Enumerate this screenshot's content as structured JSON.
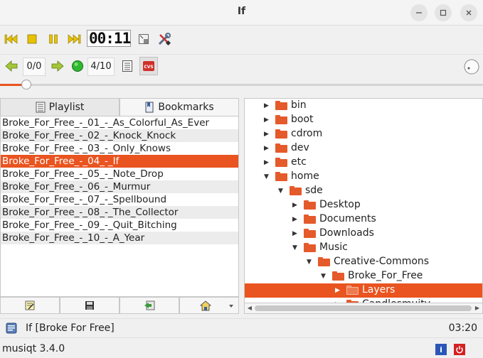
{
  "window": {
    "title": "If",
    "minimize_icon": "minimize-icon",
    "maximize_icon": "maximize-icon",
    "close_icon": "close-icon"
  },
  "transport": {
    "time_display": "00:11",
    "buttons": [
      "previous-icon",
      "stop-icon",
      "pause-icon",
      "next-icon",
      "small-window-icon",
      "settings-tools-icon"
    ]
  },
  "navigation": {
    "bookmark_counter": "0/0",
    "track_counter": "4/10",
    "buttons": [
      "back-arrow-icon",
      "forward-arrow-icon",
      "record-icon",
      "list-icon",
      "cue-sheet-icon",
      "volume-knob-icon"
    ]
  },
  "seek": {
    "position_fraction": 0.055
  },
  "tabs": [
    {
      "label": "Playlist",
      "icon": "playlist-icon",
      "active": true
    },
    {
      "label": "Bookmarks",
      "icon": "bookmarks-icon",
      "active": false
    }
  ],
  "playlist": {
    "selected_index": 3,
    "items": [
      "Broke_For_Free_-_01_-_As_Colorful_As_Ever",
      "Broke_For_Free_-_02_-_Knock_Knock",
      "Broke_For_Free_-_03_-_Only_Knows",
      "Broke_For_Free_-_04_-_If",
      "Broke_For_Free_-_05_-_Note_Drop",
      "Broke_For_Free_-_06_-_Murmur",
      "Broke_For_Free_-_07_-_Spellbound",
      "Broke_For_Free_-_08_-_The_Collector",
      "Broke_For_Free_-_09_-_Quit_Bitching",
      "Broke_For_Free_-_10_-_A_Year"
    ],
    "tool_icons": [
      "edit-icon",
      "save-icon",
      "import-icon",
      "home-icon",
      "dropdown-arrow-icon"
    ]
  },
  "tree": {
    "items": [
      {
        "label": "bin",
        "depth": 0,
        "expanded": false,
        "selected": false
      },
      {
        "label": "boot",
        "depth": 0,
        "expanded": false,
        "selected": false
      },
      {
        "label": "cdrom",
        "depth": 0,
        "expanded": false,
        "selected": false
      },
      {
        "label": "dev",
        "depth": 0,
        "expanded": false,
        "selected": false
      },
      {
        "label": "etc",
        "depth": 0,
        "expanded": false,
        "selected": false
      },
      {
        "label": "home",
        "depth": 0,
        "expanded": true,
        "selected": false
      },
      {
        "label": "sde",
        "depth": 1,
        "expanded": true,
        "selected": false
      },
      {
        "label": "Desktop",
        "depth": 2,
        "expanded": false,
        "selected": false
      },
      {
        "label": "Documents",
        "depth": 2,
        "expanded": false,
        "selected": false
      },
      {
        "label": "Downloads",
        "depth": 2,
        "expanded": false,
        "selected": false
      },
      {
        "label": "Music",
        "depth": 2,
        "expanded": true,
        "selected": false
      },
      {
        "label": "Creative-Commons",
        "depth": 3,
        "expanded": true,
        "selected": false
      },
      {
        "label": "Broke_For_Free",
        "depth": 4,
        "expanded": true,
        "selected": false
      },
      {
        "label": "Layers",
        "depth": 5,
        "expanded": false,
        "selected": true
      },
      {
        "label": "Candlesmuity",
        "depth": 5,
        "expanded": false,
        "selected": false
      }
    ]
  },
  "status": {
    "now_playing": "If [Broke For Free]",
    "remaining_time": "03:20"
  },
  "footer": {
    "version": "musiqt 3.4.0",
    "info_icon": "info-icon",
    "power_icon": "power-icon"
  }
}
